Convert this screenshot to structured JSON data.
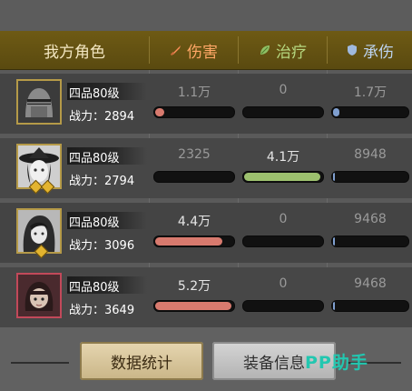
{
  "header": {
    "team_label": "我方角色",
    "damage_label": "伤害",
    "heal_label": "治疗",
    "tank_label": "承伤",
    "damage_color": "#ffa766",
    "heal_color": "#b6d880",
    "tank_color": "#bcd3ef"
  },
  "rows": [
    {
      "rank": "四品80级",
      "power": "战力：2894",
      "damage": "1.1万",
      "heal": "0",
      "tank": "1.7万",
      "damage_fill": 0.12,
      "heal_fill": 0.0,
      "tank_fill": 0.08,
      "stars": 0,
      "portrait": "helmet-knight"
    },
    {
      "rank": "四品80级",
      "power": "战力：2794",
      "damage": "2325",
      "heal": "4.1万",
      "tank": "8948",
      "damage_fill": 0.0,
      "heal_fill": 0.98,
      "tank_fill": 0.03,
      "stars": 2,
      "portrait": "witch-hat"
    },
    {
      "rank": "四品80级",
      "power": "战力：3096",
      "damage": "4.4万",
      "heal": "0",
      "tank": "9468",
      "damage_fill": 0.86,
      "heal_fill": 0.0,
      "tank_fill": 0.03,
      "stars": 1,
      "portrait": "dark-hair"
    },
    {
      "rank": "四品80级",
      "power": "战力：3649",
      "damage": "5.2万",
      "heal": "0",
      "tank": "9468",
      "damage_fill": 0.98,
      "heal_fill": 0.0,
      "tank_fill": 0.03,
      "stars": 0,
      "portrait": "bob-hair-girl"
    }
  ],
  "bar_colors": {
    "damage": "#d87a6e",
    "heal": "#9cc06e",
    "tank": "#7f9fcf"
  },
  "footer": {
    "stats_button": "数据统计",
    "equip_button": "装备信息",
    "watermark": "PP助手"
  }
}
